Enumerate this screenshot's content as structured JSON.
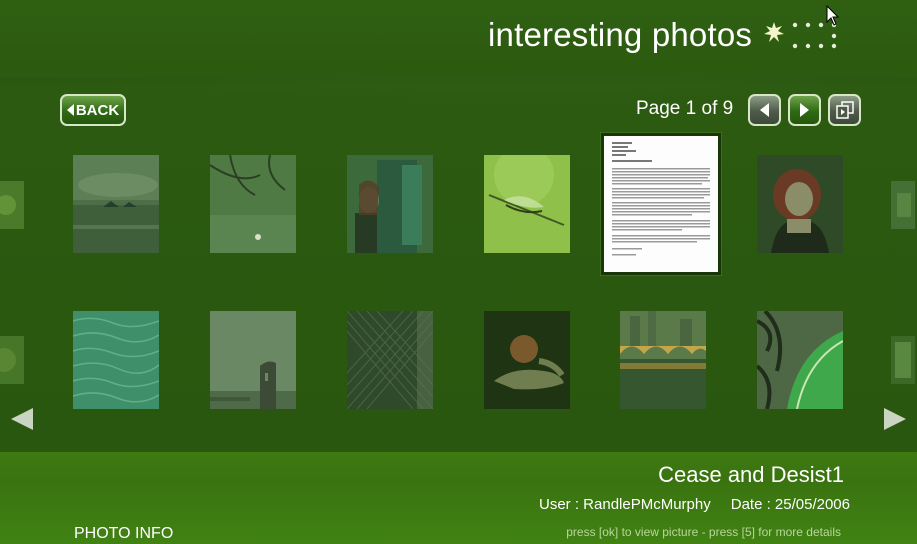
{
  "header": {
    "title": "interesting photos",
    "logo_icon": "sparkle-logo-icon"
  },
  "toolbar": {
    "back_label": "BACK",
    "page_label": "Page 1 of 9",
    "prev_icon": "triangle-left-icon",
    "next_icon": "triangle-right-icon",
    "slideshow_icon": "slideshow-icon"
  },
  "gallery": {
    "rows": [
      [
        {
          "name": "seascape-rocks"
        },
        {
          "name": "tree-branch-buoy"
        },
        {
          "name": "girl-in-doorway"
        },
        {
          "name": "dragonfly"
        },
        {
          "name": "cease-and-desist-document",
          "selected": true
        },
        {
          "name": "red-haired-woman"
        }
      ],
      [
        {
          "name": "water-ripples"
        },
        {
          "name": "ruined-tower"
        },
        {
          "name": "chainlink-fence"
        },
        {
          "name": "hand-holding-egg"
        },
        {
          "name": "bridge-reflection"
        },
        {
          "name": "zebra-and-leaf"
        }
      ]
    ],
    "scroll_left_icon": "scroll-left-icon",
    "scroll_right_icon": "scroll-right-icon"
  },
  "selected_photo": {
    "title": "Cease and Desist1",
    "user": "User : RandlePMcMurphy",
    "date": "Date : 25/05/2006"
  },
  "footer": {
    "photo_info_label": "PHOTO INFO",
    "hint": "press [ok] to view picture   -    press [5] for more details"
  },
  "colors": {
    "background": "#2c5a10",
    "bottom_band": "#418213",
    "accent": "#7fc22a"
  }
}
